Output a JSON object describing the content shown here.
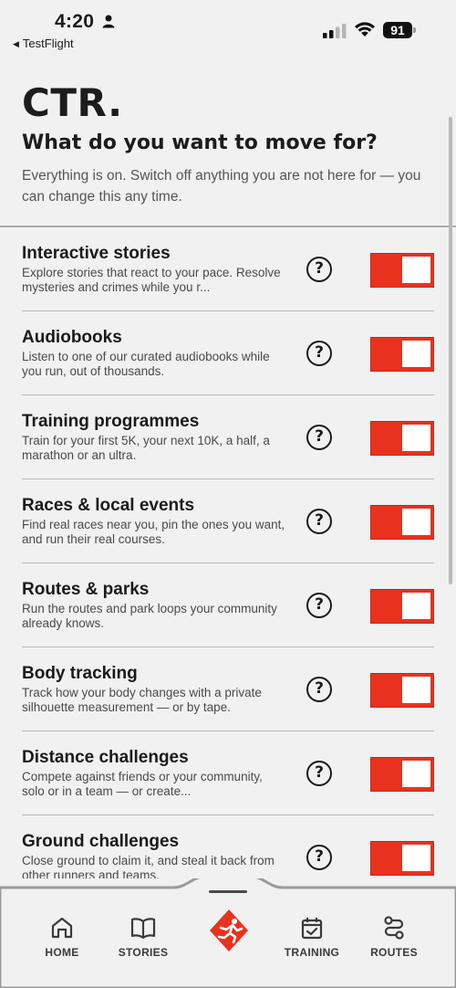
{
  "status_bar": {
    "time": "4:20",
    "back_app": "TestFlight",
    "battery": "91"
  },
  "header": {
    "brand": "CTR.",
    "title": "What do you want to move for?",
    "subtitle": "Everything is on. Switch off anything you are not here for — you can change this any time."
  },
  "features": [
    {
      "title": "Interactive stories",
      "desc": "Explore stories that react to your pace. Resolve mysteries and crimes while you r...",
      "enabled": true
    },
    {
      "title": "Audiobooks",
      "desc": "Listen to one of our curated audiobooks while you run, out of thousands.",
      "enabled": true
    },
    {
      "title": "Training programmes",
      "desc": "Train for your first 5K, your next 10K, a half, a marathon or an ultra.",
      "enabled": true
    },
    {
      "title": "Races & local events",
      "desc": "Find real races near you, pin the ones you want, and run their real courses.",
      "enabled": true
    },
    {
      "title": "Routes & parks",
      "desc": "Run the routes and park loops your community already knows.",
      "enabled": true
    },
    {
      "title": "Body tracking",
      "desc": "Track how your body changes with a private silhouette measurement — or by tape.",
      "enabled": true
    },
    {
      "title": "Distance challenges",
      "desc": "Compete against friends or your community, solo or in a team — or create...",
      "enabled": true
    },
    {
      "title": "Ground challenges",
      "desc": "Close ground to claim it, and steal it back from other runners and teams.",
      "enabled": true
    }
  ],
  "help_glyph": "?",
  "nav": {
    "home": "HOME",
    "stories": "STORIES",
    "training": "TRAINING",
    "routes": "ROUTES",
    "icons": [
      "home-icon",
      "book-icon",
      "runner-icon",
      "calendar-check-icon",
      "route-icon"
    ]
  },
  "colors": {
    "accent": "#e8321e",
    "background": "#f1f1f1",
    "text": "#1c1c1c"
  }
}
